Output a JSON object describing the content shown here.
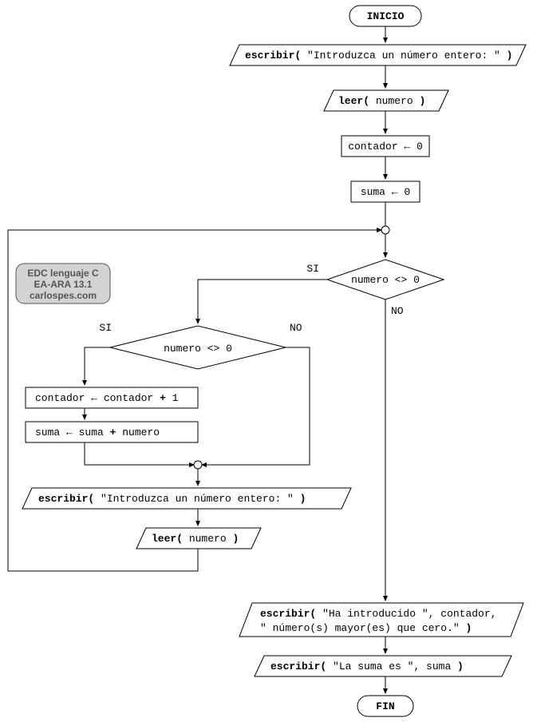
{
  "nodes": {
    "start": "INICIO",
    "write1_func": "escribir(",
    "write1_arg": " \"Introduzca un número entero: \" ",
    "write1_close": ")",
    "read1_func": "leer(",
    "read1_arg": " numero ",
    "read1_close": ")",
    "proc1": "contador ← 0",
    "proc2": "suma ← 0",
    "dec1": "numero <> 0",
    "dec1_yes": "SI",
    "dec1_no": "NO",
    "dec2": "numero <> 0",
    "dec2_yes": "SI",
    "dec2_no": "NO",
    "proc3_a": "contador ← contador ",
    "proc3_op": "+",
    "proc3_b": " 1",
    "proc4_a": "suma ← suma ",
    "proc4_op": "+",
    "proc4_b": " numero",
    "write2_func": "escribir(",
    "write2_arg": " \"Introduzca un número entero: \" ",
    "write2_close": ")",
    "read2_func": "leer(",
    "read2_arg": " numero ",
    "read2_close": ")",
    "write3_func": "escribir(",
    "write3_arg1": " \"Ha introducido \", contador,",
    "write3_arg2": "\" número(s) mayor(es) que cero.\" ",
    "write3_close": ")",
    "write4_func": "escribir(",
    "write4_arg": " \"La suma es \", suma ",
    "write4_close": ")",
    "end": "FIN"
  },
  "badge": {
    "line1": "EDC lenguaje C",
    "line2": "EA-ARA 13.1",
    "line3": "carlospes.com"
  }
}
